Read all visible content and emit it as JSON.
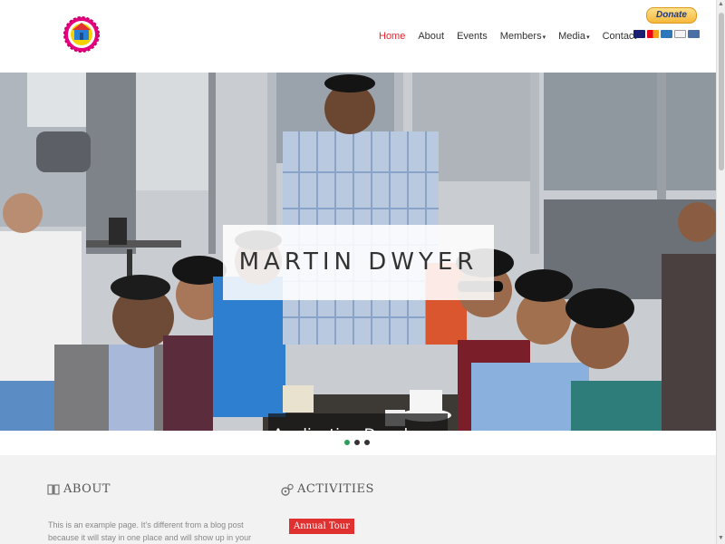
{
  "header": {
    "logo": {
      "icon": "temple-logo-icon"
    },
    "nav": [
      {
        "label": "Home",
        "active": true,
        "dropdown": false
      },
      {
        "label": "About",
        "active": false,
        "dropdown": false
      },
      {
        "label": "Events",
        "active": false,
        "dropdown": false
      },
      {
        "label": "Members",
        "active": false,
        "dropdown": true
      },
      {
        "label": "Media",
        "active": false,
        "dropdown": true
      },
      {
        "label": "Contact",
        "active": false,
        "dropdown": false
      }
    ],
    "donate_label": "Donate",
    "payment_cards": [
      "visa",
      "mastercard",
      "amex",
      "discover",
      "bank"
    ]
  },
  "hero": {
    "title": "MARTIN DWYER",
    "subtitle": "Application Developer",
    "slides": 3,
    "active_slide": 1
  },
  "about": {
    "heading": "ABOUT",
    "icon": "book-icon",
    "text": "This is an example page. It's different from a blog post because it will stay in one place and will show up in your site navigation"
  },
  "activities": {
    "heading": "ACTIVITIES",
    "icon": "gears-icon",
    "badge": "Annual Tour"
  },
  "colors": {
    "accent": "#e8232a",
    "nav_text": "#333333",
    "dot_active": "#2a9d5a",
    "section_bg": "#f2f2f2"
  }
}
